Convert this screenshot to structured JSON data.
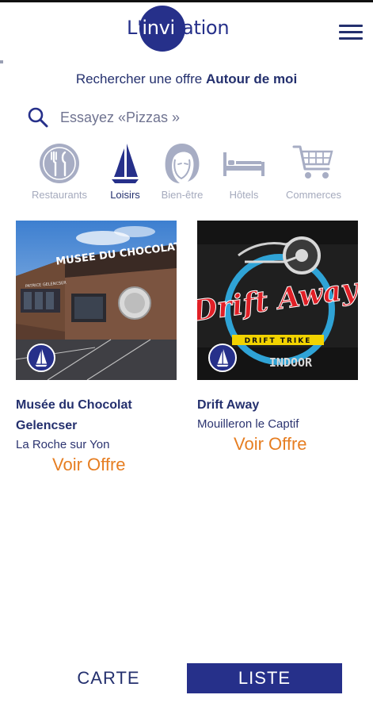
{
  "app": {
    "logo": "L'invitation",
    "menu_icon": "hamburger-menu-icon"
  },
  "around_me": {
    "prefix": "Rechercher une offre",
    "link": "Autour de moi"
  },
  "search": {
    "placeholder": "Essayez «Pizzas »",
    "icon": "search-icon"
  },
  "categories": [
    {
      "label": "Restaurants",
      "icon": "fork-knife-icon",
      "active": false
    },
    {
      "label": "Loisirs",
      "icon": "sailboat-icon",
      "active": true
    },
    {
      "label": "Bien-être",
      "icon": "woman-face-icon",
      "active": false
    },
    {
      "label": "Hôtels",
      "icon": "bed-icon",
      "active": false
    },
    {
      "label": "Commerces",
      "icon": "shopping-cart-icon",
      "active": false
    }
  ],
  "offers": [
    {
      "title": "Musée du Chocolat Gelencser",
      "city": "La Roche sur Yon",
      "cta": "Voir Offre",
      "image_sign": "MUSEE DU CHOCOLAT",
      "image_subsign": "PATRICE GELENCSER",
      "category_icon": "sailboat-icon"
    },
    {
      "title": "Drift Away",
      "city": "Mouilleron le Captif",
      "cta": "Voir Offre",
      "image_logo": "Drift Away",
      "image_tagline": "DRIFT TRIKE",
      "image_bottom": "INDOOR",
      "category_icon": "sailboat-icon"
    }
  ],
  "view_toggle": {
    "map": "CARTE",
    "list": "LISTE",
    "selected": "LISTE"
  },
  "colors": {
    "brand_navy": "#26308a",
    "text_navy": "#24306e",
    "accent_orange": "#e67e22",
    "inactive_gray": "#a5aabd"
  }
}
